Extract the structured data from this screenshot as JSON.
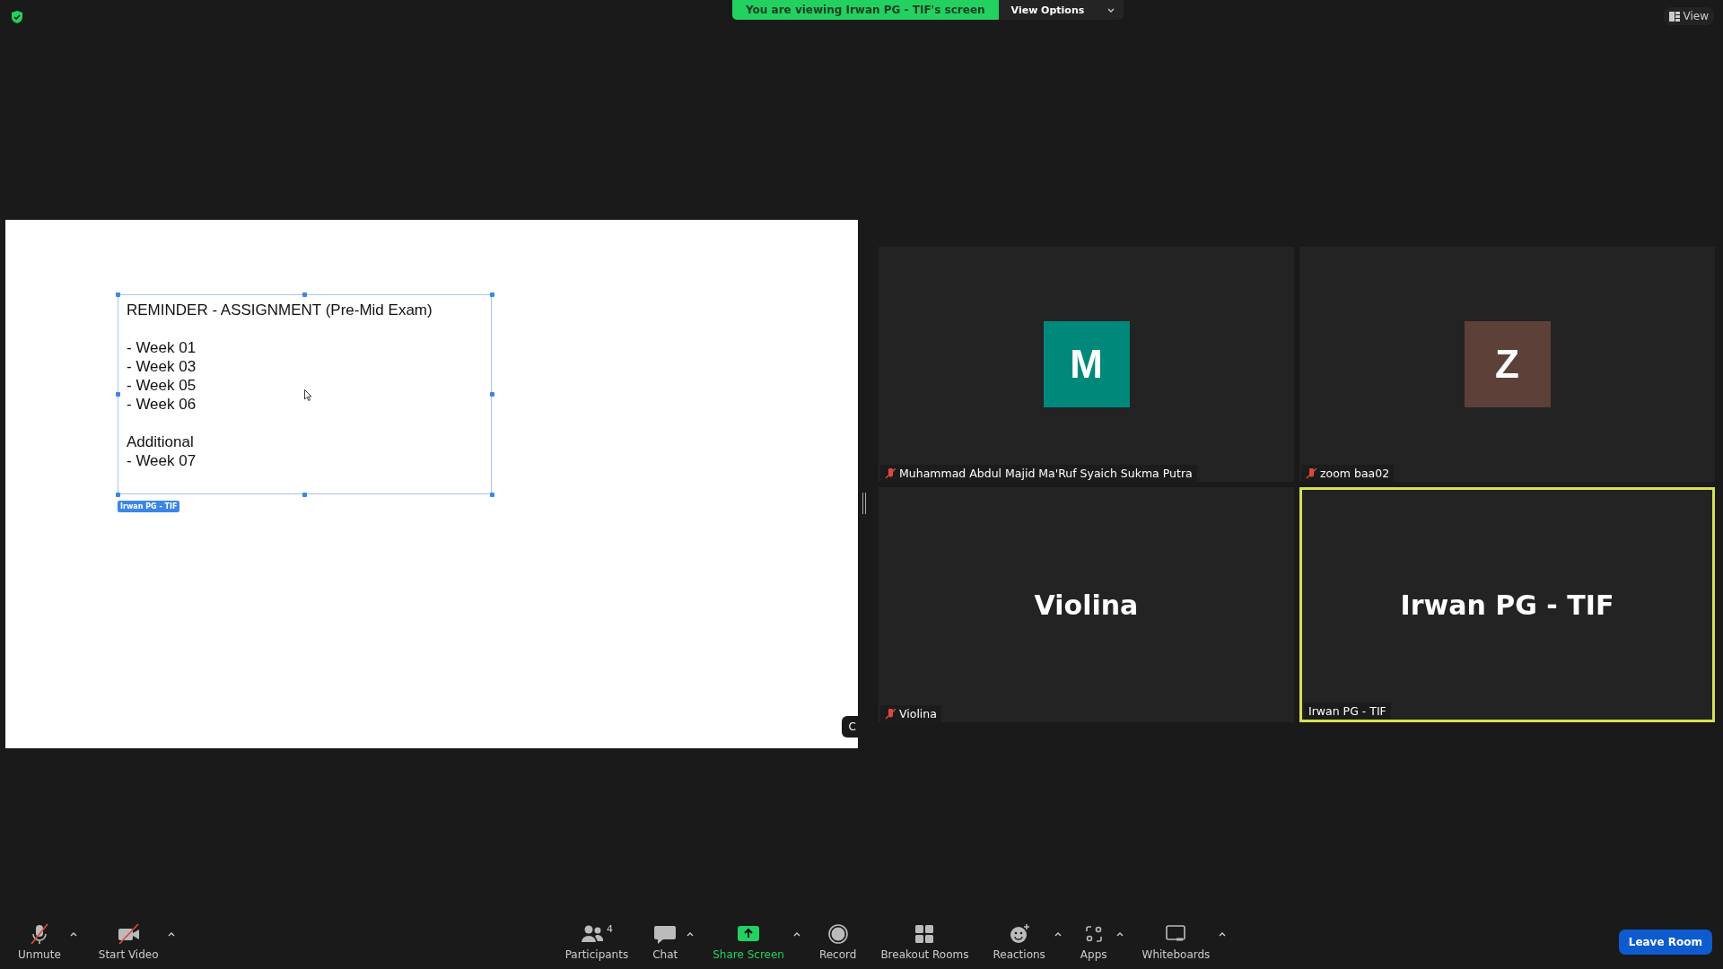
{
  "top_bar": {
    "banner": "You are viewing Irwan PG - TIF's screen",
    "view_options": "View Options",
    "view_button": "View"
  },
  "shared_screen": {
    "text_box": {
      "lines": [
        {
          "kind": "heading",
          "text": "REMINDER - ASSIGNMENT (Pre-Mid Exam)"
        },
        {
          "kind": "gap"
        },
        {
          "kind": "line",
          "text": "- Week 01"
        },
        {
          "kind": "line",
          "text": "- Week 03"
        },
        {
          "kind": "line",
          "text": "- Week 05"
        },
        {
          "kind": "line",
          "text": "- Week 06"
        },
        {
          "kind": "gap"
        },
        {
          "kind": "line",
          "text": "Additional"
        },
        {
          "kind": "line",
          "text": "- Week 07"
        }
      ],
      "annotator": "Irwan PG - TIF"
    },
    "side_tab": "C"
  },
  "tiles": [
    {
      "kind": "avatar",
      "initial": "M",
      "color": "#00897b",
      "name": "Muhammad Abdul Majid Ma'Ruf Syaich Sukma Putra",
      "muted": true,
      "speaking": false
    },
    {
      "kind": "avatar",
      "initial": "Z",
      "color": "#5d4037",
      "name": "zoom baa02",
      "muted": true,
      "speaking": false
    },
    {
      "kind": "name_card",
      "display_name": "Violina",
      "name": "Violina",
      "muted": true,
      "speaking": false
    },
    {
      "kind": "name_card",
      "display_name": "Irwan PG - TIF",
      "name": "Irwan PG - TIF",
      "muted": false,
      "speaking": true
    }
  ],
  "toolbar": {
    "left": [
      {
        "kind": "mic",
        "label": "Unmute",
        "caret": true
      },
      {
        "kind": "video",
        "label": "Start Video",
        "caret": true
      }
    ],
    "center": [
      {
        "kind": "participants",
        "label": "Participants",
        "count": "4",
        "caret": false
      },
      {
        "kind": "chat",
        "label": "Chat",
        "caret": true
      },
      {
        "kind": "share",
        "label": "Share Screen",
        "caret": true
      },
      {
        "kind": "record",
        "label": "Record",
        "caret": false
      },
      {
        "kind": "breakout",
        "label": "Breakout Rooms",
        "caret": false
      },
      {
        "kind": "reactions",
        "label": "Reactions",
        "caret": true
      },
      {
        "kind": "apps",
        "label": "Apps",
        "caret": true
      },
      {
        "kind": "whiteboard",
        "label": "Whiteboards",
        "caret": true
      }
    ],
    "leave": "Leave Room"
  }
}
